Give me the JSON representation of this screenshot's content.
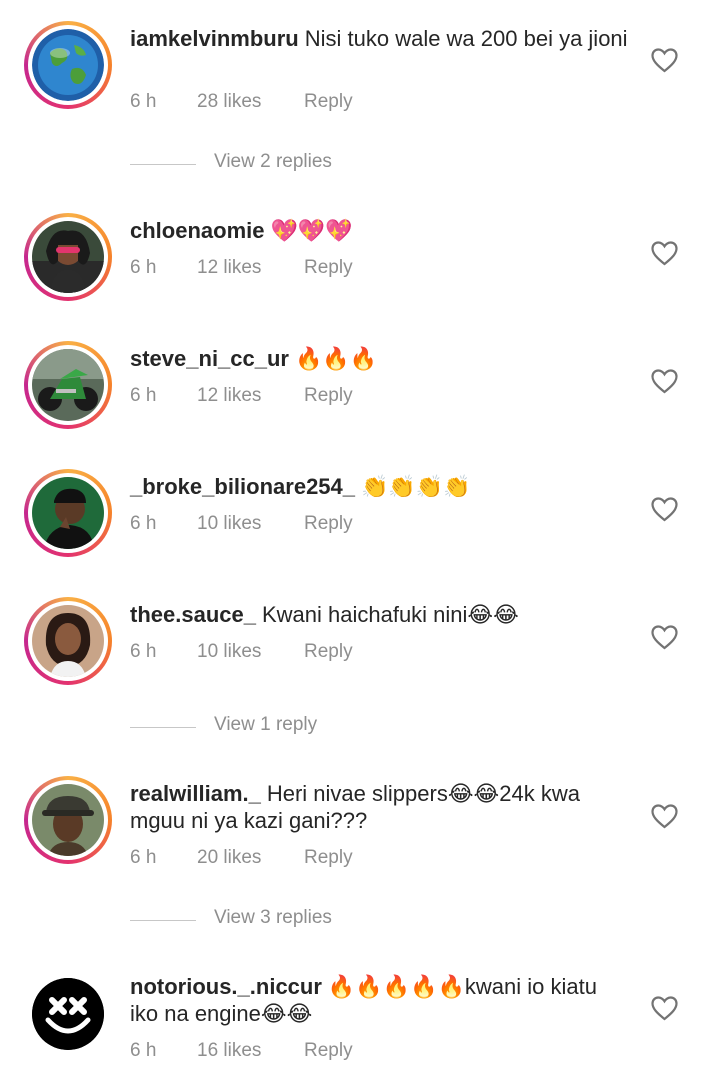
{
  "comments": [
    {
      "username": "iamkelvinmburu",
      "text": "Nisi tuko wale wa  200 bei ya jioni",
      "time": "6 h",
      "likes": "28 likes",
      "reply": "Reply",
      "view_replies": "View 2 replies",
      "avatar_icon": "globe-avatar"
    },
    {
      "username": "chloenaomie",
      "text": "💖💖💖",
      "time": "6 h",
      "likes": "12 likes",
      "reply": "Reply",
      "avatar_icon": "profile-photo-avatar"
    },
    {
      "username": "steve_ni_cc_ur",
      "text": "🔥🔥🔥",
      "time": "6 h",
      "likes": "12 likes",
      "reply": "Reply",
      "avatar_icon": "motorbike-avatar"
    },
    {
      "username": "_broke_bilionare254_",
      "text": "👏👏👏👏",
      "time": "6 h",
      "likes": "10 likes",
      "reply": "Reply",
      "avatar_icon": "profile-photo-avatar"
    },
    {
      "username": "thee.sauce_",
      "text": "Kwani haichafuki nini😂😂",
      "time": "6 h",
      "likes": "10 likes",
      "reply": "Reply",
      "view_replies": "View 1 reply",
      "avatar_icon": "profile-photo-avatar"
    },
    {
      "username": "realwilliam._",
      "text": "Heri nivae slippers😂😂24k kwa mguu ni ya kazi gani???",
      "time": "6 h",
      "likes": "20 likes",
      "reply": "Reply",
      "view_replies": "View 3 replies",
      "avatar_icon": "profile-photo-avatar"
    },
    {
      "username": "notorious._.niccur",
      "text": "🔥🔥🔥🔥🔥kwani io kiatu iko na engine😂😂",
      "time": "6 h",
      "likes": "16 likes",
      "reply": "Reply",
      "avatar_icon": "marshmello-face-avatar"
    }
  ],
  "icons": {
    "like": "heart-outline-icon"
  },
  "colors": {
    "meta_text": "#8e8e8e",
    "ring_start": "#f9b046",
    "ring_end": "#c5278f"
  }
}
